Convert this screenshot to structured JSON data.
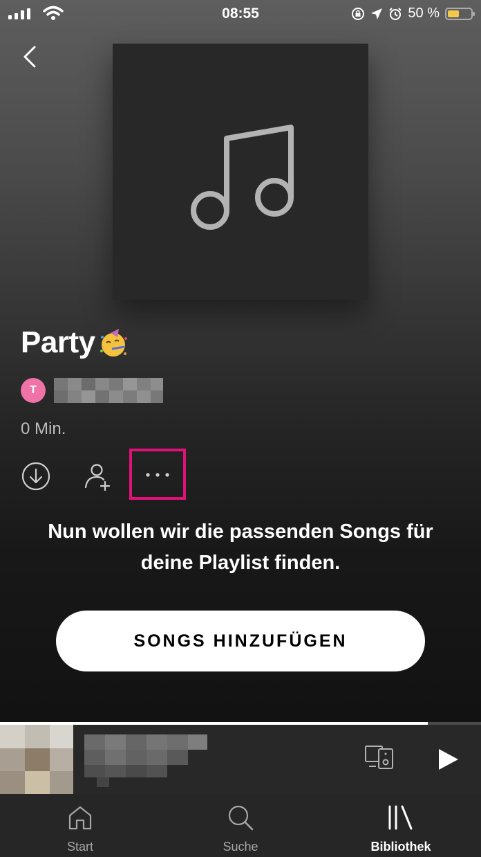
{
  "status_bar": {
    "time": "08:55",
    "battery": "50 %",
    "battery_level": 0.45,
    "battery_color": "#f2c94c"
  },
  "playlist": {
    "title": "Party",
    "title_emoji_icon": "party-face-emoji-icon",
    "owner_initial": "T",
    "owner_avatar_color": "#f073a8",
    "duration": "0 Min."
  },
  "actions": {
    "download_icon": "download-icon",
    "add_collaborator_icon": "add-user-icon",
    "more_icon": "more-dots-icon",
    "highlight_color": "#e0127a"
  },
  "empty_state": {
    "line1": "Nun wollen wir die passenden Songs für",
    "line2": "deine Playlist finden."
  },
  "cta": {
    "label": "SONGS HINZUFÜGEN"
  },
  "mini_player": {
    "progress": 0.89,
    "devices_icon": "devices-icon",
    "play_icon": "play-icon"
  },
  "tabs": [
    {
      "label": "Start",
      "icon": "home-icon",
      "active": false
    },
    {
      "label": "Suche",
      "icon": "search-icon",
      "active": false
    },
    {
      "label": "Bibliothek",
      "icon": "library-icon",
      "active": true
    }
  ]
}
